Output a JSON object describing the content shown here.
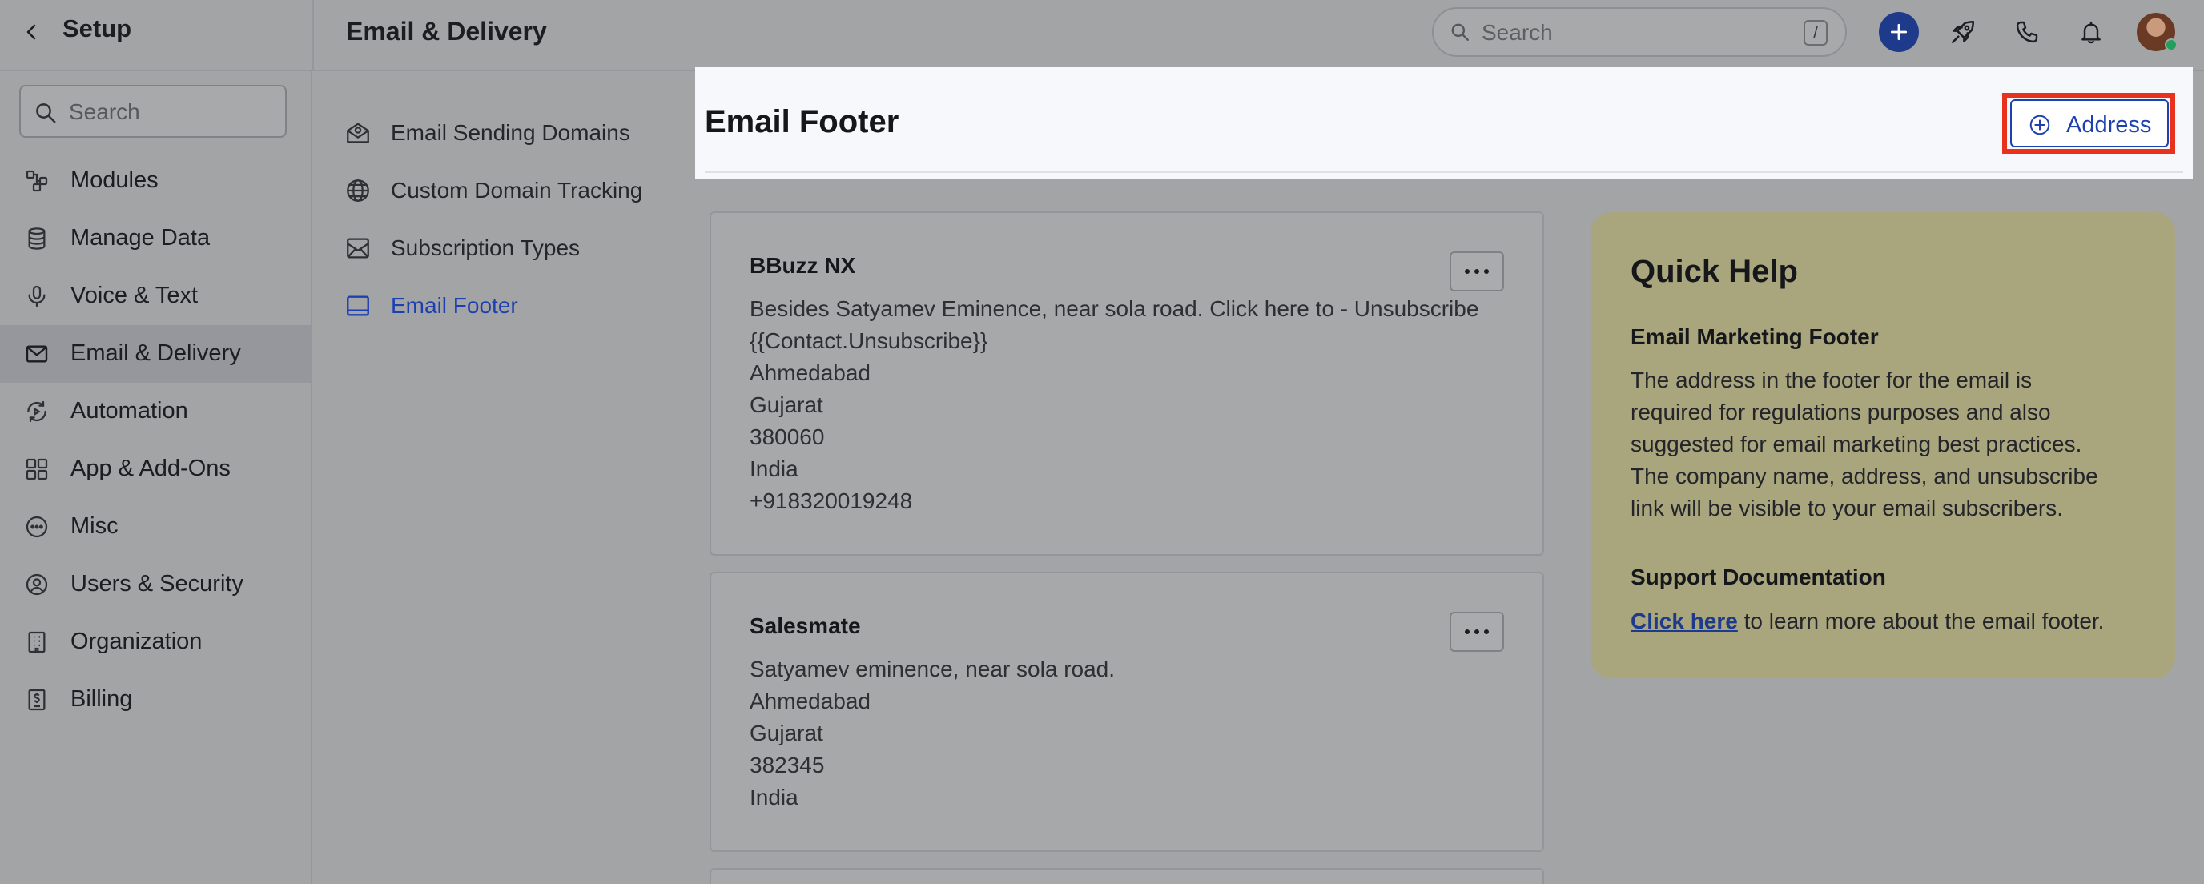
{
  "app": {
    "setup_title": "Setup",
    "page_title": "Email & Delivery"
  },
  "topbar": {
    "search_placeholder": "Search",
    "search_shortcut": "/",
    "icons": [
      "plus-icon",
      "rocket-icon",
      "phone-icon",
      "bell-icon",
      "avatar"
    ],
    "accent_color": "#1e3a8a",
    "presence_color": "#22a05b"
  },
  "sidebar": {
    "search_placeholder": "Search",
    "active_item": "Email & Delivery",
    "items": [
      {
        "label": "Modules",
        "icon": "modules-icon"
      },
      {
        "label": "Manage Data",
        "icon": "database-icon"
      },
      {
        "label": "Voice & Text",
        "icon": "microphone-icon"
      },
      {
        "label": "Email & Delivery",
        "icon": "envelope-icon"
      },
      {
        "label": "Automation",
        "icon": "automation-icon"
      },
      {
        "label": "App & Add-Ons",
        "icon": "apps-grid-icon"
      },
      {
        "label": "Misc",
        "icon": "more-circle-icon"
      },
      {
        "label": "Users & Security",
        "icon": "user-circle-icon"
      },
      {
        "label": "Organization",
        "icon": "building-icon"
      },
      {
        "label": "Billing",
        "icon": "billing-icon"
      }
    ]
  },
  "subnav": {
    "active_item": "Email Footer",
    "items": [
      {
        "label": "Email Sending Domains",
        "icon": "mail-domain-icon"
      },
      {
        "label": "Custom Domain Tracking",
        "icon": "globe-icon"
      },
      {
        "label": "Subscription Types",
        "icon": "inbox-icon"
      },
      {
        "label": "Email Footer",
        "icon": "footer-icon"
      }
    ]
  },
  "main": {
    "title": "Email Footer",
    "add_button_label": "Address",
    "highlight_color": "#e8321e",
    "cards": [
      {
        "name": "BBuzz NX",
        "lines": [
          "Besides Satyamev Eminence, near sola road. Click here to - Unsubscribe",
          "{{Contact.Unsubscribe}}",
          "Ahmedabad",
          "Gujarat",
          "380060",
          "India",
          "+918320019248"
        ]
      },
      {
        "name": "Salesmate",
        "lines": [
          "Satyamev eminence, near sola road.",
          "Ahmedabad",
          "Gujarat",
          "382345",
          "India"
        ]
      }
    ]
  },
  "quick_help": {
    "title": "Quick Help",
    "section1_title": "Email Marketing Footer",
    "section1_lines": [
      "The address in the footer for the email is",
      "required for regulations purposes and also",
      "suggested for email marketing best practices.",
      "The company name, address, and unsubscribe",
      "link will be visible to your email subscribers."
    ],
    "section2_title": "Support Documentation",
    "link_text": "Click here",
    "link_suffix": " to learn more about the email footer."
  }
}
